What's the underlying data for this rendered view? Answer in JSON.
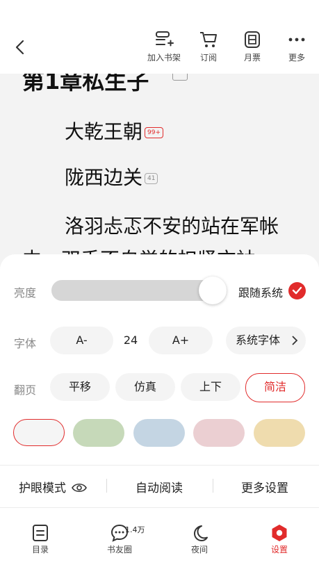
{
  "toolbar": {
    "items": [
      {
        "label": "加入书架",
        "icon": "add-to-shelf-icon"
      },
      {
        "label": "订阅",
        "icon": "cart-icon"
      },
      {
        "label": "月票",
        "icon": "ticket-icon"
      },
      {
        "label": "更多",
        "icon": "more-dots-icon"
      }
    ]
  },
  "reader": {
    "chapter_title": "第1章私生子",
    "paragraphs": [
      {
        "text": "大乾王朝",
        "comment_count": "99+"
      },
      {
        "text": "陇西边关",
        "comment_count": "41"
      },
      {
        "text": "洛羽忐忑不安的站在军帐",
        "comment_count": ""
      },
      {
        "text": "中，双手不自觉的扣紧衣袖。",
        "comment_count": ""
      }
    ]
  },
  "settings": {
    "brightness": {
      "label": "亮度",
      "level": 0.85,
      "follow_system_label": "跟随系统",
      "follow_system": true
    },
    "font": {
      "label": "字体",
      "decrease": "A-",
      "size": "24",
      "increase": "A+",
      "family": "系统字体"
    },
    "page_turn": {
      "label": "翻页",
      "options": [
        "平移",
        "仿真",
        "上下",
        "简洁"
      ],
      "selected": "简洁"
    },
    "themes": [
      {
        "color": "#f5f5f5",
        "selected": true
      },
      {
        "color": "#c6d9b9",
        "selected": false
      },
      {
        "color": "#c4d5e3",
        "selected": false
      },
      {
        "color": "#ebcfd2",
        "selected": false
      },
      {
        "color": "#efdcae",
        "selected": false
      }
    ],
    "bottom_options": {
      "eye_care": "护眼模式",
      "auto_read": "自动阅读",
      "more_settings": "更多设置"
    }
  },
  "bottom_nav": {
    "items": [
      {
        "label": "目录",
        "icon": "catalog-icon"
      },
      {
        "label": "书友圈",
        "icon": "chat-bubble-icon",
        "badge": "1.4万"
      },
      {
        "label": "夜间",
        "icon": "moon-icon"
      },
      {
        "label": "设置",
        "icon": "settings-hex-icon",
        "active": true
      }
    ]
  },
  "colors": {
    "accent": "#e12b2b",
    "sheet_bg": "#ffffff",
    "page_bg": "#f3f3f3"
  }
}
